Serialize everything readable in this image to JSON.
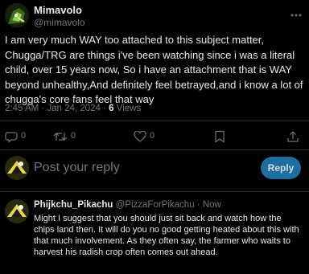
{
  "main_post": {
    "author_name": "Mimavolo",
    "author_handle": "@mimavolo",
    "text": "I am very much WAY too attached to this subject matter, Chugga/TRG are things i've been watching since i was a literal child, over 15 years now, So i have an attachment that is WAY beyond unhealthy,And definitely feel betrayed,and i know a lot of chugga's core fans feel that way",
    "timestamp": "2:45 AM · Jan 24, 2024 · ",
    "views_count": "6",
    "views_label": " Views"
  },
  "actions": {
    "reply_count": "0",
    "repost_count": "0",
    "like_count": "0",
    "icons": [
      "reply-icon",
      "repost-icon",
      "like-icon",
      "bookmark-icon",
      "share-icon"
    ]
  },
  "composer": {
    "placeholder": "Post your reply",
    "reply_button": "Reply"
  },
  "reply_post": {
    "author_name": "Phijkchu_Pikachu",
    "author_handle": "@PizzaForPikachu",
    "separator": " · ",
    "time": "Now",
    "text": "Might I suggest that you should just sit back and watch how the chips land then. It will do you no good getting heated about this with that much involvement. As they often say, the farmer who waits to harvest his radish crop often comes out ahead."
  },
  "colors": {
    "background": "#000000",
    "text": "#e7e9ea",
    "muted": "#71767b",
    "divider": "#2f3336",
    "reply_button_bg": "#1d6f9f"
  }
}
